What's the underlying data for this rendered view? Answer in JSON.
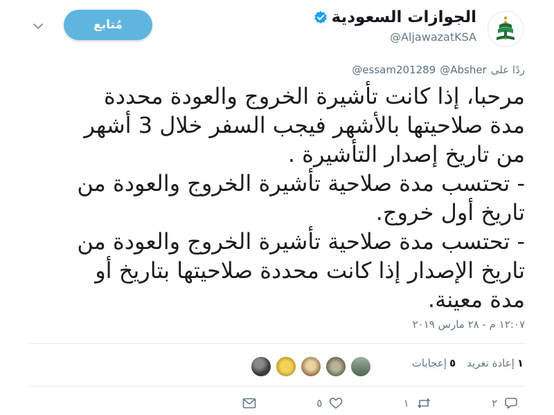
{
  "author": {
    "display_name": "الجوازات السعودية",
    "handle": "@AljawazatKSA",
    "verified": true,
    "avatar_icon": "emblem-icon"
  },
  "follow_button": {
    "label": "مُتابع"
  },
  "menu_icon": "chevron-down-icon",
  "reply": {
    "prefix": "ردًا على",
    "mentions": [
      "@Absher",
      "@essam201289"
    ]
  },
  "tweet": {
    "lines": [
      "مرحبا، إذا كانت تأشيرة الخروج والعودة محددة",
      "مدة صلاحيتها بالأشهر فيجب السفر خلال 3 أشهر",
      "من تاريخ إصدار التأشيرة .",
      "- تحتسب مدة صلاحية تأشيرة الخروج والعودة من",
      "تاريخ أول خروج.",
      "- تحتسب مدة صلاحية تأشيرة الخروج والعودة من",
      "تاريخ الإصدار إذا كانت محددة صلاحيتها بتاريخ أو",
      "مدة معينة."
    ]
  },
  "timestamp": "١٢:٠٧ م - ٢٨ مارس ٢٠١٩",
  "stats": {
    "retweets_count": "١",
    "retweets_label": "إعادة تغريد",
    "likes_count": "٥",
    "likes_label": "إعجابات"
  },
  "likers": [
    {
      "name": "liker-1",
      "color": "#3a3a3a"
    },
    {
      "name": "liker-2",
      "color": "#e8c13c"
    },
    {
      "name": "liker-3",
      "color": "#c9a46a"
    },
    {
      "name": "liker-4",
      "color": "#7d7a5e"
    },
    {
      "name": "liker-5",
      "color": "#5f7360"
    }
  ],
  "actions": {
    "reply_count": "٢",
    "retweet_count": "١",
    "like_count": "٥"
  },
  "colors": {
    "accent": "#5eb6e0",
    "verified": "#1da1f2",
    "muted": "#657786",
    "emblem_green": "#1f6b3a",
    "emblem_gold": "#c9a227"
  }
}
